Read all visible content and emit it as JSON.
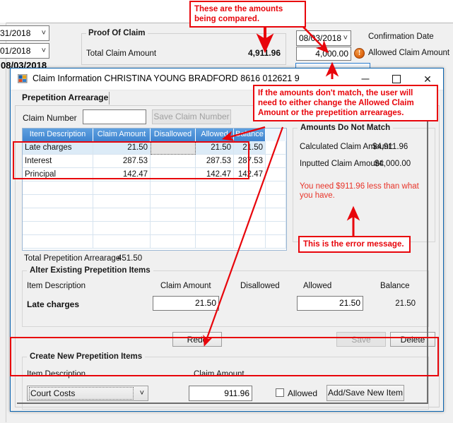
{
  "background": {
    "date_combo_1": "31/2018",
    "date_combo_2": "01/2018",
    "bold_date": "08/03/2018",
    "proof_of_claim": {
      "group_title": "Proof Of Claim",
      "total_claim_label": "Total Claim Amount",
      "total_claim_value": "4,911.96"
    },
    "confirmation_date_combo": "08/03/2018",
    "confirmation_date_label": "Confirmation Date",
    "allowed_claim_value": "4,000.00",
    "allowed_claim_label": "Allowed Claim Amount",
    "warn_icon_glyph": "!"
  },
  "dialog": {
    "title": "Claim Information  CHRISTINA YOUNG BRADFORD 8616 012621 9",
    "window_icon": "application-icon",
    "minimize": "—",
    "maximize": "",
    "close": "✕",
    "tab_label": "Prepetition Arrearage",
    "claim_number_label": "Claim Number",
    "claim_number_value": "",
    "save_claim_number_button": "Save Claim Number",
    "grid": {
      "columns": [
        "Item Description",
        "Claim Amount",
        "Disallowed",
        "Allowed",
        "Balance",
        ""
      ],
      "rows": [
        {
          "desc": "Late charges",
          "claim": "21.50",
          "disallowed": "",
          "allowed": "21.50",
          "balance": "21.50",
          "selected": true
        },
        {
          "desc": "Interest",
          "claim": "287.53",
          "disallowed": "",
          "allowed": "287.53",
          "balance": "287.53",
          "selected": false
        },
        {
          "desc": "Principal",
          "claim": "142.47",
          "disallowed": "",
          "allowed": "142.47",
          "balance": "142.47",
          "selected": false
        },
        {
          "desc": "",
          "claim": "",
          "disallowed": "",
          "allowed": "",
          "balance": "",
          "selected": false
        },
        {
          "desc": "",
          "claim": "",
          "disallowed": "",
          "allowed": "",
          "balance": "",
          "selected": false
        },
        {
          "desc": "",
          "claim": "",
          "disallowed": "",
          "allowed": "",
          "balance": "",
          "selected": false
        },
        {
          "desc": "",
          "claim": "",
          "disallowed": "",
          "allowed": "",
          "balance": "",
          "selected": false
        },
        {
          "desc": "",
          "claim": "",
          "disallowed": "",
          "allowed": "",
          "balance": "",
          "selected": false
        }
      ]
    },
    "total_prepetition_label": "Total Prepetition Arrearage",
    "total_prepetition_value": "451.50",
    "mismatch_panel": {
      "title": "Amounts Do Not Match",
      "calculated_label": "Calculated Claim Amount:",
      "calculated_value": "$4,911.96",
      "inputted_label": "Inputted Claim Amount:",
      "inputted_value": "$4,000.00",
      "error_message": "You need $911.96 less than what you have."
    },
    "alter_existing": {
      "title": "Alter Existing Prepetition Items",
      "col_item": "Item Description",
      "col_claim": "Claim Amount",
      "col_disallowed": "Disallowed",
      "col_allowed": "Allowed",
      "col_balance": "Balance",
      "row_item": "Late charges",
      "row_claim": "21.50",
      "row_allowed": "21.50",
      "row_balance": "21.50"
    },
    "buttons": {
      "redo": "Redo",
      "save": "Save",
      "delete": "Delete"
    },
    "create_new": {
      "title": "Create New Prepetition Items",
      "item_label": "Item Description",
      "claim_label": "Claim Amount",
      "item_value": "Court Costs",
      "claim_value": "911.96",
      "allowed_checkbox_label": "Allowed",
      "add_button": "Add/Save New Item"
    }
  },
  "annotations": {
    "amounts_compared": "These are the amounts being compared.",
    "mismatch_note": "If the amounts don't match, the user will need to either change the Allowed Claim Amount or the prepetition arrearages.",
    "error_message_note": "This is the error message.",
    "accent_color": "#e8050b"
  }
}
